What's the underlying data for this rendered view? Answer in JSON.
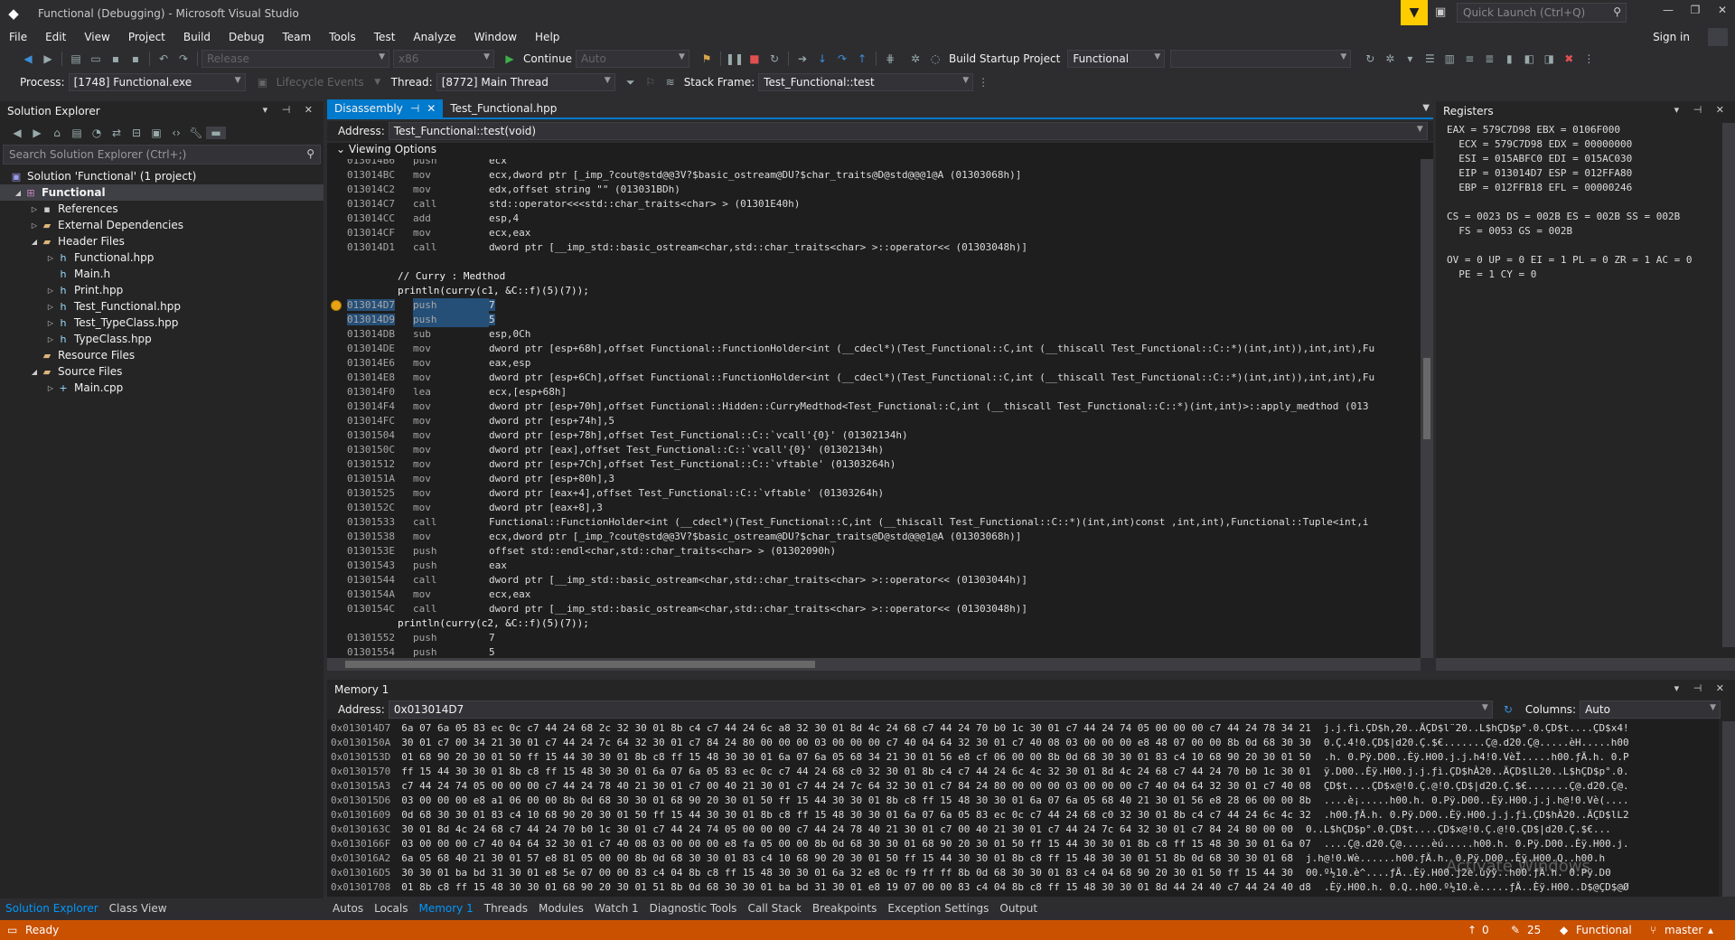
{
  "window": {
    "title": "Functional (Debugging) - Microsoft Visual Studio",
    "quick_launch": "Quick Launch (Ctrl+Q)",
    "sign_in": "Sign in"
  },
  "menu": [
    "File",
    "Edit",
    "View",
    "Project",
    "Build",
    "Debug",
    "Team",
    "Tools",
    "Test",
    "Analyze",
    "Window",
    "Help"
  ],
  "toolbar1": {
    "config": "Release",
    "platform": "x86",
    "continue": "Continue",
    "auto": "Auto",
    "build_startup": "Build Startup Project",
    "startup_project": "Functional"
  },
  "toolbar2": {
    "process_label": "Process:",
    "process": "[1748] Functional.exe",
    "lifecycle": "Lifecycle Events",
    "thread_label": "Thread:",
    "thread": "[8772] Main Thread",
    "stack_label": "Stack Frame:",
    "stack": "Test_Functional::test"
  },
  "solution_explorer": {
    "title": "Solution Explorer",
    "search": "Search Solution Explorer (Ctrl+;)",
    "items": [
      {
        "label": "Solution 'Functional' (1 project)"
      },
      {
        "label": "Functional"
      },
      {
        "label": "References"
      },
      {
        "label": "External Dependencies"
      },
      {
        "label": "Header Files"
      },
      {
        "label": "Functional.hpp"
      },
      {
        "label": "Main.h"
      },
      {
        "label": "Print.hpp"
      },
      {
        "label": "Test_Functional.hpp"
      },
      {
        "label": "Test_TypeClass.hpp"
      },
      {
        "label": "TypeClass.hpp"
      },
      {
        "label": "Resource Files"
      },
      {
        "label": "Source Files"
      },
      {
        "label": "Main.cpp"
      }
    ],
    "tabs": [
      "Solution Explorer",
      "Class View"
    ]
  },
  "doc_tabs": [
    "Disassembly",
    "Test_Functional.hpp"
  ],
  "address": {
    "label": "Address:",
    "value": "Test_Functional::test(void)"
  },
  "viewing_options": "Viewing Options",
  "disassembly": {
    "lines": [
      {
        "a": "013014B6",
        "m": "push",
        "o": "ecx"
      },
      {
        "a": "013014BC",
        "m": "mov",
        "o": "ecx,dword ptr [_imp_?cout@std@@3V?$basic_ostream@DU?$char_traits@D@std@@@1@A (01303068h)]"
      },
      {
        "a": "013014C2",
        "m": "mov",
        "o": "edx,offset string \"\" (013031BDh)"
      },
      {
        "a": "013014C7",
        "m": "call",
        "o": "std::operator<<<std::char_traits<char> > (01301E40h)"
      },
      {
        "a": "013014CC",
        "m": "add",
        "o": "esp,4"
      },
      {
        "a": "013014CF",
        "m": "mov",
        "o": "ecx,eax"
      },
      {
        "a": "013014D1",
        "m": "call",
        "o": "dword ptr [__imp_std::basic_ostream<char,std::char_traits<char> >::operator<< (01303048h)]"
      },
      {
        "src": ""
      },
      {
        "src": "// Curry : Medthod"
      },
      {
        "src": "println(curry(c1, &C::f)(5)(7));"
      },
      {
        "a": "013014D7",
        "m": "push",
        "o": "7",
        "hl": true
      },
      {
        "a": "013014D9",
        "m": "push",
        "o": "5",
        "hl": true
      },
      {
        "a": "013014DB",
        "m": "sub",
        "o": "esp,0Ch"
      },
      {
        "a": "013014DE",
        "m": "mov",
        "o": "dword ptr [esp+68h],offset Functional::FunctionHolder<int (__cdecl*)(Test_Functional::C,int (__thiscall Test_Functional::C::*)(int,int)),int,int),Fu"
      },
      {
        "a": "013014E6",
        "m": "mov",
        "o": "eax,esp"
      },
      {
        "a": "013014E8",
        "m": "mov",
        "o": "dword ptr [esp+6Ch],offset Functional::FunctionHolder<int (__cdecl*)(Test_Functional::C,int (__thiscall Test_Functional::C::*)(int,int)),int,int),Fu"
      },
      {
        "a": "013014F0",
        "m": "lea",
        "o": "ecx,[esp+68h]"
      },
      {
        "a": "013014F4",
        "m": "mov",
        "o": "dword ptr [esp+70h],offset Functional::Hidden::CurryMedthod<Test_Functional::C,int (__thiscall Test_Functional::C::*)(int,int)>::apply_medthod (013"
      },
      {
        "a": "013014FC",
        "m": "mov",
        "o": "dword ptr [esp+74h],5"
      },
      {
        "a": "01301504",
        "m": "mov",
        "o": "dword ptr [esp+78h],offset Test_Functional::C::`vcall'{0}' (01302134h)"
      },
      {
        "a": "0130150C",
        "m": "mov",
        "o": "dword ptr [eax],offset Test_Functional::C::`vcall'{0}' (01302134h)"
      },
      {
        "a": "01301512",
        "m": "mov",
        "o": "dword ptr [esp+7Ch],offset Test_Functional::C::`vftable' (01303264h)"
      },
      {
        "a": "0130151A",
        "m": "mov",
        "o": "dword ptr [esp+80h],3"
      },
      {
        "a": "01301525",
        "m": "mov",
        "o": "dword ptr [eax+4],offset Test_Functional::C::`vftable' (01303264h)"
      },
      {
        "a": "0130152C",
        "m": "mov",
        "o": "dword ptr [eax+8],3"
      },
      {
        "a": "01301533",
        "m": "call",
        "o": "Functional::FunctionHolder<int (__cdecl*)(Test_Functional::C,int (__thiscall Test_Functional::C::*)(int,int)const ,int,int),Functional::Tuple<int,i"
      },
      {
        "a": "01301538",
        "m": "mov",
        "o": "ecx,dword ptr [_imp_?cout@std@@3V?$basic_ostream@DU?$char_traits@D@std@@@1@A (01303068h)]"
      },
      {
        "a": "0130153E",
        "m": "push",
        "o": "offset std::endl<char,std::char_traits<char> > (01302090h)"
      },
      {
        "a": "01301543",
        "m": "push",
        "o": "eax"
      },
      {
        "a": "01301544",
        "m": "call",
        "o": "dword ptr [__imp_std::basic_ostream<char,std::char_traits<char> >::operator<< (01303044h)]"
      },
      {
        "a": "0130154A",
        "m": "mov",
        "o": "ecx,eax"
      },
      {
        "a": "0130154C",
        "m": "call",
        "o": "dword ptr [__imp_std::basic_ostream<char,std::char_traits<char> >::operator<< (01303048h)]"
      },
      {
        "src": "println(curry(c2, &C::f)(5)(7));"
      },
      {
        "a": "01301552",
        "m": "push",
        "o": "7"
      },
      {
        "a": "01301554",
        "m": "push",
        "o": "5"
      }
    ]
  },
  "registers": {
    "title": "Registers",
    "lines": [
      "EAX = 579C7D98 EBX = 0106F000",
      "  ECX = 579C7D98 EDX = 00000000",
      "  ESI = 015ABFC0 EDI = 015AC030",
      "  EIP = 013014D7 ESP = 012FFA80",
      "  EBP = 012FFB18 EFL = 00000246",
      "",
      "CS = 0023 DS = 002B ES = 002B SS = 002B",
      "  FS = 0053 GS = 002B",
      "",
      "OV = 0 UP = 0 EI = 1 PL = 0 ZR = 1 AC = 0",
      "  PE = 1 CY = 0"
    ]
  },
  "memory": {
    "title": "Memory 1",
    "address_label": "Address:",
    "address": "0x013014D7",
    "columns_label": "Columns:",
    "columns": "Auto",
    "lines": [
      {
        "a": "0x013014D7",
        "h": "6a 07 6a 05 83 ec 0c c7 44 24 68 2c 32 30 01 8b c4 c7 44 24 6c a8 32 30 01 8d 4c 24 68 c7 44 24 70 b0 1c 30 01 c7 44 24 74 05 00 00 00 c7 44 24 78 34 21",
        "t": "j.j.fì.ÇD$h,20..ÄÇD$l¨20..L$hÇD$p°.0.ÇD$t....ÇD$x4!"
      },
      {
        "a": "0x0130150A",
        "h": "30 01 c7 00 34 21 30 01 c7 44 24 7c 64 32 30 01 c7 84 24 80 00 00 00 03 00 00 00 c7 40 04 64 32 30 01 c7 40 08 03 00 00 00 e8 48 07 00 00 8b 0d 68 30 30",
        "t": "0.Ç.4!0.ÇD$|d20.Ç.$€.......Ç@.d20.Ç@.....èH.....h00"
      },
      {
        "a": "0x0130153D",
        "h": "01 68 90 20 30 01 50 ff 15 44 30 30 01 8b c8 ff 15 48 30 30 01 6a 07 6a 05 68 34 21 30 01 56 e8 cf 06 00 00 8b 0d 68 30 30 01 83 c4 10 68 90 20 30 01 50",
        "t": ".h. 0.Pÿ.D00..Èÿ.H00.j.j.h4!0.VèÏ.....h00.ƒÄ.h. 0.P"
      },
      {
        "a": "0x01301570",
        "h": "ff 15 44 30 30 01 8b c8 ff 15 48 30 30 01 6a 07 6a 05 83 ec 0c c7 44 24 68 c0 32 30 01 8b c4 c7 44 24 6c 4c 32 30 01 8d 4c 24 68 c7 44 24 70 b0 1c 30 01",
        "t": "ÿ.D00..Èÿ.H00.j.j.ƒì.ÇD$hÀ20..ÄÇD$lL20..L$hÇD$p°.0."
      },
      {
        "a": "0x013015A3",
        "h": "c7 44 24 74 05 00 00 00 c7 44 24 78 40 21 30 01 c7 00 40 21 30 01 c7 44 24 7c 64 32 30 01 c7 84 24 80 00 00 00 03 00 00 00 c7 40 04 64 32 30 01 c7 40 08",
        "t": "ÇD$t....ÇD$x@!0.Ç.@!0.ÇD$|d20.Ç.$€.......Ç@.d20.Ç@."
      },
      {
        "a": "0x013015D6",
        "h": "03 00 00 00 e8 a1 06 00 00 8b 0d 68 30 30 01 68 90 20 30 01 50 ff 15 44 30 30 01 8b c8 ff 15 48 30 30 01 6a 07 6a 05 68 40 21 30 01 56 e8 28 06 00 00 8b",
        "t": "....è¡.....h00.h. 0.Pÿ.D00..Èÿ.H00.j.j.h@!0.Vè(...."
      },
      {
        "a": "0x01301609",
        "h": "0d 68 30 30 01 83 c4 10 68 90 20 30 01 50 ff 15 44 30 30 01 8b c8 ff 15 48 30 30 01 6a 07 6a 05 83 ec 0c c7 44 24 68 c0 32 30 01 8b c4 c7 44 24 6c 4c 32",
        "t": ".h00.ƒÄ.h. 0.Pÿ.D00..Èÿ.H00.j.j.ƒì.ÇD$hÀ20..ÄÇD$lL2"
      },
      {
        "a": "0x0130163C",
        "h": "30 01 8d 4c 24 68 c7 44 24 70 b0 1c 30 01 c7 44 24 74 05 00 00 00 c7 44 24 78 40 21 30 01 c7 00 40 21 30 01 c7 44 24 7c 64 32 30 01 c7 84 24 80 00 00",
        "t": "0..L$hÇD$p°.0.ÇD$t....ÇD$x@!0.Ç.@!0.ÇD$|d20.Ç.$€..."
      },
      {
        "a": "0x0130166F",
        "h": "03 00 00 00 c7 40 04 64 32 30 01 c7 40 08 03 00 00 00 e8 fa 05 00 00 8b 0d 68 30 30 01 68 90 20 30 01 50 ff 15 44 30 30 01 8b c8 ff 15 48 30 30 01 6a 07",
        "t": "....Ç@.d20.Ç@.....èú.....h00.h. 0.Pÿ.D00..Èÿ.H00.j."
      },
      {
        "a": "0x013016A2",
        "h": "6a 05 68 40 21 30 01 57 e8 81 05 00 00 8b 0d 68 30 30 01 83 c4 10 68 90 20 30 01 50 ff 15 44 30 30 01 8b c8 ff 15 48 30 30 01 51 8b 0d 68 30 30 01 68",
        "t": "j.h@!0.Wè......h00.ƒÄ.h. 0.Pÿ.D00..Èÿ.H00.Q..h00.h"
      },
      {
        "a": "0x013016D5",
        "h": "30 30 01 ba bd 31 30 01 e8 5e 07 00 00 83 c4 04 8b c8 ff 15 48 30 30 01 6a 32 e8 0c f9 ff ff 8b 0d 68 30 30 01 83 c4 04 68 90 20 30 01 50 ff 15 44 30",
        "t": "00.º½10.è^....ƒÄ..Èÿ.H00.j2è.ùÿÿ..h00.ƒÄ.h. 0.Pÿ.D0"
      },
      {
        "a": "0x01301708",
        "h": "01 8b c8 ff 15 48 30 30 01 68 90 20 30 01 51 8b 0d 68 30 30 01 ba bd 31 30 01 e8 19 07 00 00 83 c4 04 8b c8 ff 15 48 30 30 01 8d 44 24 40 c7 44 24 40 d8",
        "t": ".Èÿ.H00.h. 0.Q..h00.º½10.è.....ƒÄ..Èÿ.H00..D$@ÇD$@Ø"
      }
    ]
  },
  "bottom_tabs": [
    "Autos",
    "Locals",
    "Memory 1",
    "Threads",
    "Modules",
    "Watch 1",
    "Diagnostic Tools",
    "Call Stack",
    "Breakpoints",
    "Exception Settings",
    "Output"
  ],
  "status": {
    "ready": "Ready",
    "up": "0",
    "edits": "25",
    "project": "Functional",
    "branch": "master"
  },
  "watermark": "Activate Windows"
}
